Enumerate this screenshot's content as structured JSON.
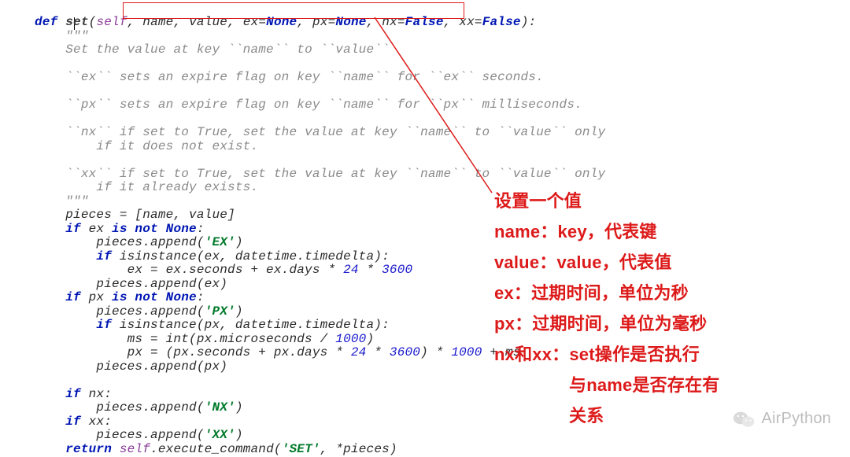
{
  "code": {
    "tokens": [
      [
        "kw",
        "def "
      ],
      [
        "def",
        "set"
      ],
      [
        "op",
        "("
      ],
      [
        "self",
        "self"
      ],
      [
        "op",
        ", "
      ],
      [
        "id",
        "name"
      ],
      [
        "op",
        ", "
      ],
      [
        "id",
        "value"
      ],
      [
        "op",
        ", "
      ],
      [
        "id",
        "ex"
      ],
      [
        "op",
        "="
      ],
      [
        "none",
        "None"
      ],
      [
        "op",
        ", "
      ],
      [
        "id",
        "px"
      ],
      [
        "op",
        "="
      ],
      [
        "none",
        "None"
      ],
      [
        "op",
        ", "
      ],
      [
        "id",
        "nx"
      ],
      [
        "op",
        "="
      ],
      [
        "none",
        "False"
      ],
      [
        "op",
        ", "
      ],
      [
        "id",
        "xx"
      ],
      [
        "op",
        "="
      ],
      [
        "none",
        "False"
      ],
      [
        "op",
        "):"
      ],
      [
        "nl",
        ""
      ],
      [
        "op",
        "    "
      ],
      [
        "doc",
        "\"\"\""
      ],
      [
        "nl",
        ""
      ],
      [
        "op",
        "    "
      ],
      [
        "doc",
        "Set the value at key ``name`` to ``value``"
      ],
      [
        "nl",
        ""
      ],
      [
        "nl",
        ""
      ],
      [
        "op",
        "    "
      ],
      [
        "doc",
        "``ex`` sets an expire flag on key ``name`` for ``ex`` seconds."
      ],
      [
        "nl",
        ""
      ],
      [
        "nl",
        ""
      ],
      [
        "op",
        "    "
      ],
      [
        "doc",
        "``px`` sets an expire flag on key ``name`` for ``px`` milliseconds."
      ],
      [
        "nl",
        ""
      ],
      [
        "nl",
        ""
      ],
      [
        "op",
        "    "
      ],
      [
        "doc",
        "``nx`` if set to True, set the value at key ``name`` to ``value`` only"
      ],
      [
        "nl",
        ""
      ],
      [
        "op",
        "    "
      ],
      [
        "doc",
        "    if it does not exist."
      ],
      [
        "nl",
        ""
      ],
      [
        "nl",
        ""
      ],
      [
        "op",
        "    "
      ],
      [
        "doc",
        "``xx`` if set to True, set the value at key ``name`` to ``value`` only"
      ],
      [
        "nl",
        ""
      ],
      [
        "op",
        "    "
      ],
      [
        "doc",
        "    if it already exists."
      ],
      [
        "nl",
        ""
      ],
      [
        "op",
        "    "
      ],
      [
        "doc",
        "\"\"\""
      ],
      [
        "nl",
        ""
      ],
      [
        "op",
        "    "
      ],
      [
        "id",
        "pieces = [name, value]"
      ],
      [
        "nl",
        ""
      ],
      [
        "op",
        "    "
      ],
      [
        "kw",
        "if "
      ],
      [
        "id",
        "ex "
      ],
      [
        "kw",
        "is not "
      ],
      [
        "none",
        "None"
      ],
      [
        "op",
        ":"
      ],
      [
        "nl",
        ""
      ],
      [
        "op",
        "        "
      ],
      [
        "id",
        "pieces.append("
      ],
      [
        "str",
        "'EX'"
      ],
      [
        "op",
        ")"
      ],
      [
        "nl",
        ""
      ],
      [
        "op",
        "        "
      ],
      [
        "kw",
        "if "
      ],
      [
        "id",
        "isinstance(ex, datetime.timedelta):"
      ],
      [
        "nl",
        ""
      ],
      [
        "op",
        "            "
      ],
      [
        "id",
        "ex = ex.seconds + ex.days * "
      ],
      [
        "num",
        "24"
      ],
      [
        "id",
        " * "
      ],
      [
        "num",
        "3600"
      ],
      [
        "nl",
        ""
      ],
      [
        "op",
        "        "
      ],
      [
        "id",
        "pieces.append(ex)"
      ],
      [
        "nl",
        ""
      ],
      [
        "op",
        "    "
      ],
      [
        "kw",
        "if "
      ],
      [
        "id",
        "px "
      ],
      [
        "kw",
        "is not "
      ],
      [
        "none",
        "None"
      ],
      [
        "op",
        ":"
      ],
      [
        "nl",
        ""
      ],
      [
        "op",
        "        "
      ],
      [
        "id",
        "pieces.append("
      ],
      [
        "str",
        "'PX'"
      ],
      [
        "op",
        ")"
      ],
      [
        "nl",
        ""
      ],
      [
        "op",
        "        "
      ],
      [
        "kw",
        "if "
      ],
      [
        "id",
        "isinstance(px, datetime.timedelta):"
      ],
      [
        "nl",
        ""
      ],
      [
        "op",
        "            "
      ],
      [
        "id",
        "ms = int(px.microseconds / "
      ],
      [
        "num",
        "1000"
      ],
      [
        "op",
        ")"
      ],
      [
        "nl",
        ""
      ],
      [
        "op",
        "            "
      ],
      [
        "id",
        "px = (px.seconds + px.days * "
      ],
      [
        "num",
        "24"
      ],
      [
        "id",
        " * "
      ],
      [
        "num",
        "3600"
      ],
      [
        "id",
        ") * "
      ],
      [
        "num",
        "1000"
      ],
      [
        "id",
        " + ms"
      ],
      [
        "nl",
        ""
      ],
      [
        "op",
        "        "
      ],
      [
        "id",
        "pieces.append(px)"
      ],
      [
        "nl",
        ""
      ],
      [
        "nl",
        ""
      ],
      [
        "op",
        "    "
      ],
      [
        "kw",
        "if "
      ],
      [
        "id",
        "nx:"
      ],
      [
        "nl",
        ""
      ],
      [
        "op",
        "        "
      ],
      [
        "id",
        "pieces.append("
      ],
      [
        "str",
        "'NX'"
      ],
      [
        "op",
        ")"
      ],
      [
        "nl",
        ""
      ],
      [
        "op",
        "    "
      ],
      [
        "kw",
        "if "
      ],
      [
        "id",
        "xx:"
      ],
      [
        "nl",
        ""
      ],
      [
        "op",
        "        "
      ],
      [
        "id",
        "pieces.append("
      ],
      [
        "str",
        "'XX'"
      ],
      [
        "op",
        ")"
      ],
      [
        "nl",
        ""
      ],
      [
        "op",
        "    "
      ],
      [
        "kw",
        "return "
      ],
      [
        "self",
        "self"
      ],
      [
        "id",
        ".execute_command("
      ],
      [
        "str",
        "'SET'"
      ],
      [
        "id",
        ", *pieces)"
      ]
    ]
  },
  "annot": {
    "l1": "设置一个值",
    "l2": "name：key，代表键",
    "l3": "value：value，代表值",
    "l4": "ex：过期时间，单位为秒",
    "l5": "px：过期时间，单位为毫秒",
    "l6": "nx和xx：set操作是否执行",
    "l7": "与name是否存在有",
    "l8": "关系"
  },
  "watermark": {
    "text": "AirPython"
  }
}
